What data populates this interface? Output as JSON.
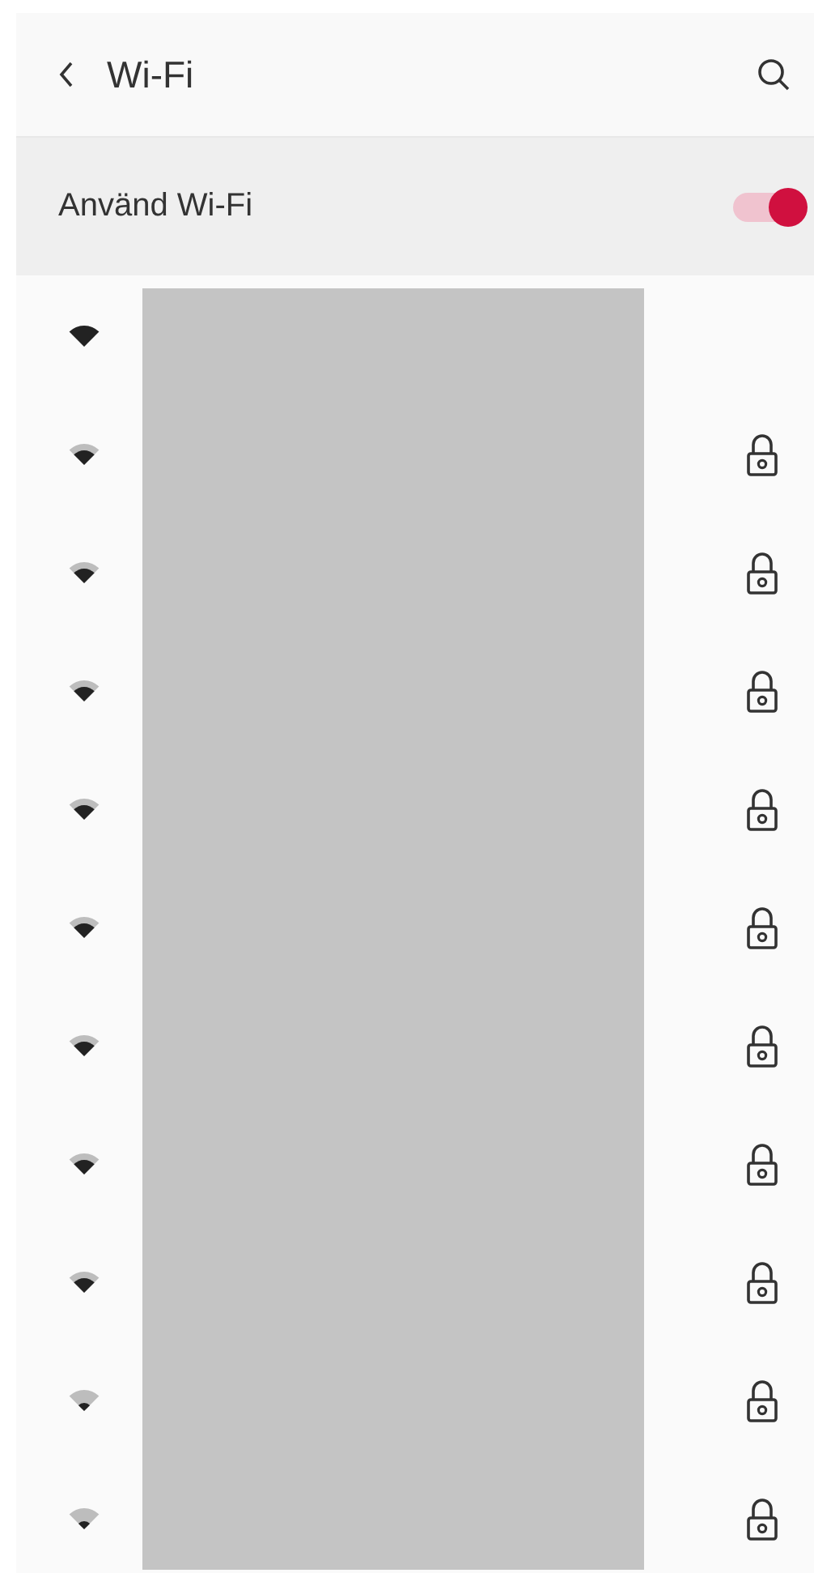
{
  "header": {
    "title": "Wi-Fi"
  },
  "wifi_toggle": {
    "label": "Använd Wi-Fi",
    "on": true
  },
  "networks": [
    {
      "kind": "full",
      "locked": false
    },
    {
      "kind": "strong",
      "locked": true
    },
    {
      "kind": "strong",
      "locked": true
    },
    {
      "kind": "strong",
      "locked": true
    },
    {
      "kind": "strong",
      "locked": true
    },
    {
      "kind": "strong",
      "locked": true
    },
    {
      "kind": "strong",
      "locked": true
    },
    {
      "kind": "strong",
      "locked": true
    },
    {
      "kind": "strong",
      "locked": true
    },
    {
      "kind": "weak",
      "locked": true
    },
    {
      "kind": "weak",
      "locked": true
    }
  ]
}
